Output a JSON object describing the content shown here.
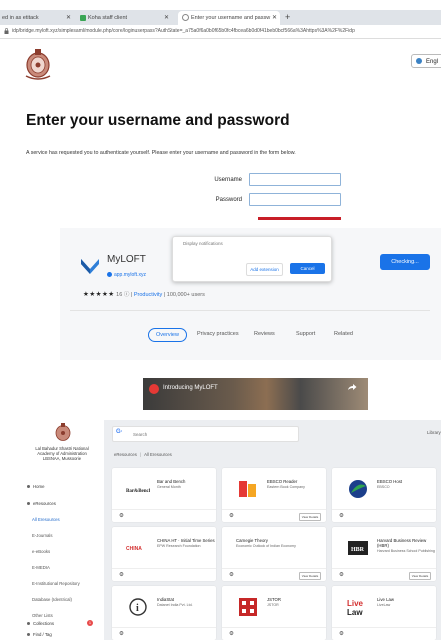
{
  "browser": {
    "tabs": [
      {
        "label": "ed in as etitack"
      },
      {
        "label": "Koha staff client"
      },
      {
        "label": "Enter your username and passw"
      }
    ],
    "url": "idp/bridge.myloft.xyz/simplesaml/module.php/core/loginuserpass?AuthState=_a75a0f6a0b0f65b0fc4fbcea6b0d0f41beb0bcf566a%3Ahttps%3A%2F%2Fidp",
    "language_button": "Engl"
  },
  "login": {
    "heading": "Enter your username and password",
    "intro": "A service has requested you to authenticate yourself. Please enter your username and password in the form below.",
    "username_label": "Username",
    "password_label": "Password",
    "username_value": "",
    "password_value": ""
  },
  "store": {
    "app_name": "MyLOFT",
    "app_link": "app.myloft.xyz",
    "stars": "★★★★★",
    "rating_count": "16",
    "category": "Productivity",
    "users": "100,000+ users",
    "popup_text": "Display notifications",
    "popup_remove": "Add extension",
    "popup_cancel": "Cancel",
    "checking": "Checking...",
    "tabs": [
      "Overview",
      "Privacy practices",
      "Reviews",
      "Support",
      "Related"
    ]
  },
  "video": {
    "title": "Introducing MyLOFT"
  },
  "dashboard": {
    "org_lines": [
      "Lal Bahadur Shastri National",
      "Academy of Administration",
      "LBSNAA, Mussoorie"
    ],
    "sidebar": [
      "Home",
      "eResources",
      "All Eresources",
      "E-Journals",
      "e-eBooks",
      "E-MEDIA",
      "E-Institutional Repository",
      "Database (Identrical)",
      "Other Lists",
      "Collections",
      "Find / Tag"
    ],
    "collections_badge": "1",
    "search_placeholder": "Search",
    "top_right": "Library",
    "breadcrumb": [
      "eResources",
      "All Eresources"
    ],
    "cards": [
      {
        "title": "Bar and Bench",
        "sub": "General Month",
        "btn": ""
      },
      {
        "title": "EBSCO Reader",
        "sub": "Eastern Book Company",
        "btn": "View Details"
      },
      {
        "title": "EBSCO Host",
        "sub": "EBSCO",
        "btn": ""
      },
      {
        "title": "CHINA HT · Initial Time Series",
        "sub": "EPW Research Foundation",
        "btn": ""
      },
      {
        "title": "Carnegie Theory",
        "sub": "Economic Outlook of Indian Economy",
        "btn": "View Details"
      },
      {
        "title": "Harvard Business Review (HBR)",
        "sub": "Harvard Business School Publishing",
        "btn": "View Details"
      },
      {
        "title": "IndiaStat",
        "sub": "Datanet India Pvt. Ltd.",
        "btn": ""
      },
      {
        "title": "JSTOR",
        "sub": "JSTOR",
        "btn": ""
      },
      {
        "title": "Live Law",
        "sub": "LiveLaw",
        "btn": ""
      }
    ]
  },
  "colors": {
    "accent": "#1a73e8",
    "danger": "#c81e28",
    "sidebar_active": "#1b66c9"
  }
}
